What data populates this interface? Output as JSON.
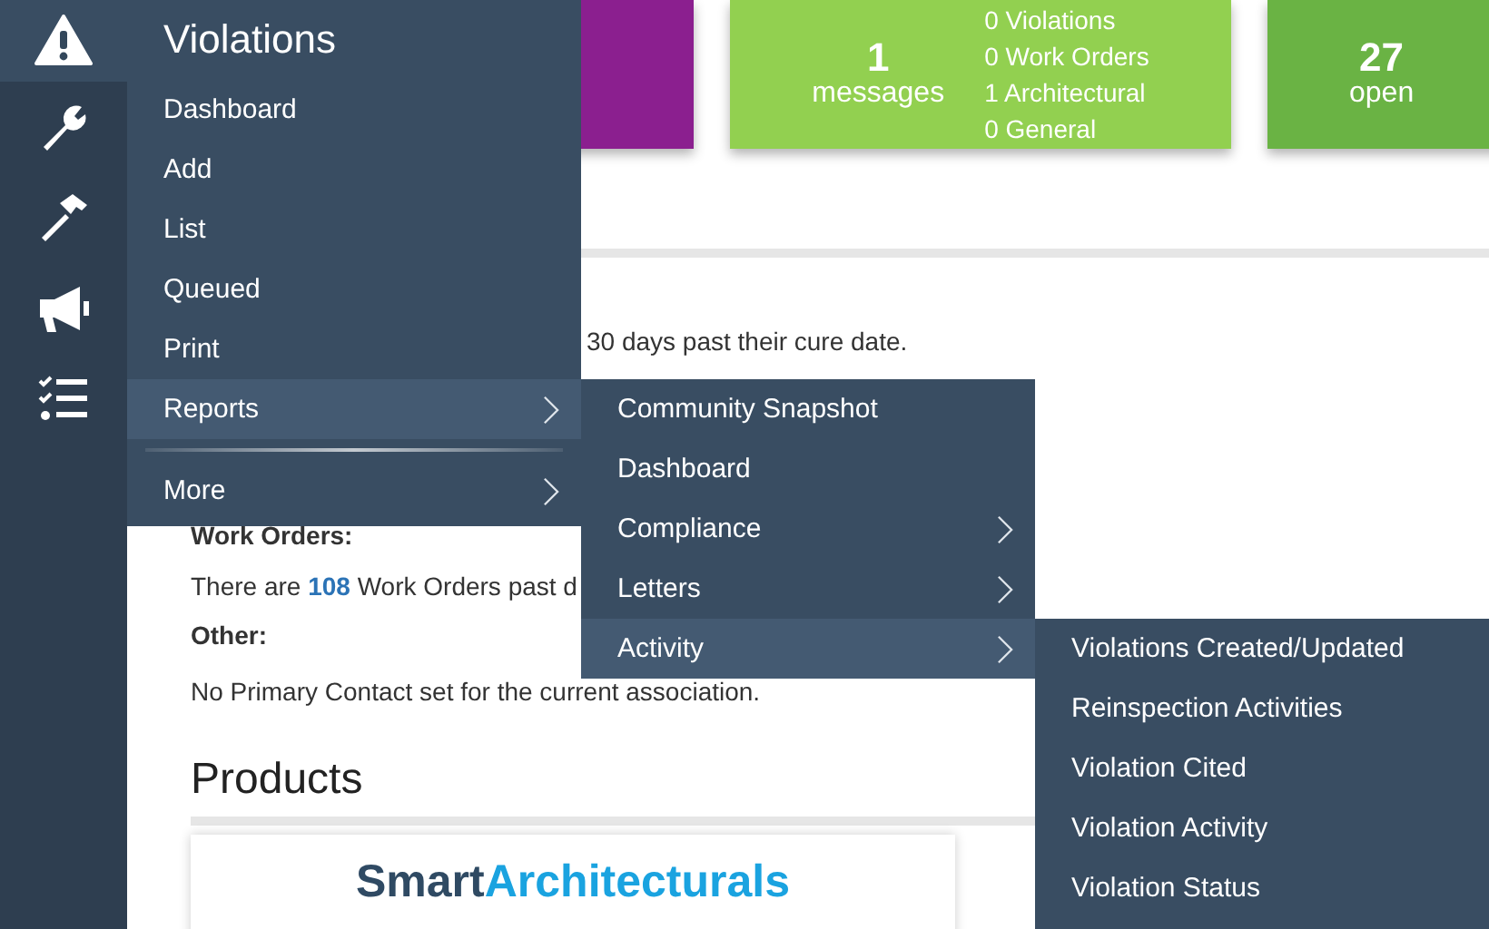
{
  "rail": [
    {
      "selected": true
    },
    {
      "selected": false
    },
    {
      "selected": false
    },
    {
      "selected": false
    },
    {
      "selected": false
    }
  ],
  "cards": [
    {
      "kind": "blank",
      "color": "#8b1f8f"
    },
    {
      "kind": "messages",
      "color": "#92d050",
      "value": "1",
      "label": "messages",
      "lines": [
        "0 Violations",
        "0 Work Orders",
        "1 Architectural",
        "0 General"
      ]
    },
    {
      "kind": "count",
      "color": "#6ab344",
      "value": "27",
      "label": "open"
    }
  ],
  "notices": [
    {
      "kind": "text",
      "text": "30 days past their cure date."
    },
    {
      "kind": "heading",
      "text": "Work Orders:"
    },
    {
      "kind": "text",
      "text": "There are **108** Work Orders past d"
    },
    {
      "kind": "heading",
      "text": "Other:"
    },
    {
      "kind": "text",
      "text": "No Primary Contact set for the current association."
    }
  ],
  "products": {
    "title": "Products",
    "logo_dark": "Smart",
    "logo_light": "Architecturals"
  },
  "menu": {
    "title": "Violations",
    "items": [
      {
        "label": "Dashboard",
        "selected": false,
        "submenu": false
      },
      {
        "label": "Add",
        "selected": false,
        "submenu": false
      },
      {
        "label": "List",
        "selected": false,
        "submenu": false
      },
      {
        "label": "Queued",
        "selected": false,
        "submenu": false
      },
      {
        "label": "Print",
        "selected": false,
        "submenu": false
      },
      {
        "label": "Reports",
        "selected": true,
        "submenu": true,
        "separator_after": true
      },
      {
        "label": "More",
        "selected": false,
        "submenu": true
      }
    ]
  },
  "submenu": {
    "items": [
      {
        "label": "Community Snapshot",
        "selected": false,
        "submenu": false
      },
      {
        "label": "Dashboard",
        "selected": false,
        "submenu": false
      },
      {
        "label": "Compliance",
        "selected": false,
        "submenu": true
      },
      {
        "label": "Letters",
        "selected": false,
        "submenu": true
      },
      {
        "label": "Activity",
        "selected": true,
        "submenu": true
      }
    ]
  },
  "subsubmenu": {
    "items": [
      {
        "label": "Violations Created/Updated",
        "selected": false,
        "submenu": false
      },
      {
        "label": "Reinspection Activities",
        "selected": false,
        "submenu": false
      },
      {
        "label": "Violation Cited",
        "selected": false,
        "submenu": false
      },
      {
        "label": "Violation Activity",
        "selected": false,
        "submenu": false
      },
      {
        "label": "Violation Status",
        "selected": false,
        "submenu": false
      }
    ]
  }
}
